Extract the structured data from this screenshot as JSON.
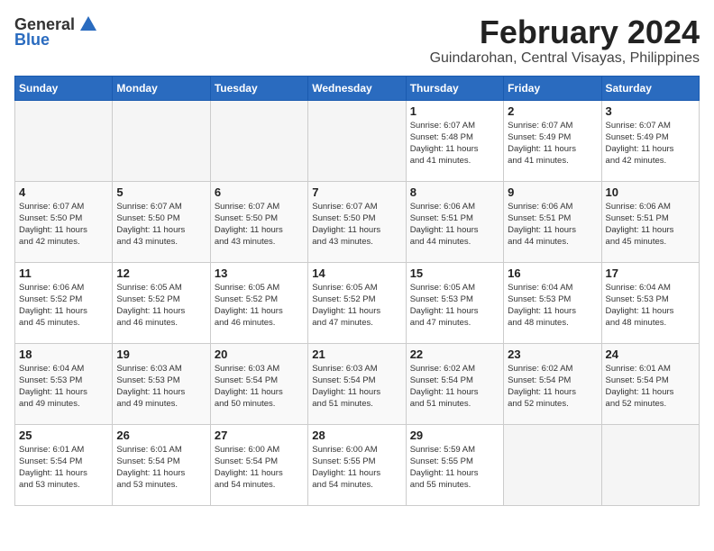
{
  "logo": {
    "general": "General",
    "blue": "Blue"
  },
  "title": {
    "month": "February 2024",
    "location": "Guindarohan, Central Visayas, Philippines"
  },
  "headers": [
    "Sunday",
    "Monday",
    "Tuesday",
    "Wednesday",
    "Thursday",
    "Friday",
    "Saturday"
  ],
  "weeks": [
    [
      {
        "day": "",
        "info": ""
      },
      {
        "day": "",
        "info": ""
      },
      {
        "day": "",
        "info": ""
      },
      {
        "day": "",
        "info": ""
      },
      {
        "day": "1",
        "info": "Sunrise: 6:07 AM\nSunset: 5:48 PM\nDaylight: 11 hours\nand 41 minutes."
      },
      {
        "day": "2",
        "info": "Sunrise: 6:07 AM\nSunset: 5:49 PM\nDaylight: 11 hours\nand 41 minutes."
      },
      {
        "day": "3",
        "info": "Sunrise: 6:07 AM\nSunset: 5:49 PM\nDaylight: 11 hours\nand 42 minutes."
      }
    ],
    [
      {
        "day": "4",
        "info": "Sunrise: 6:07 AM\nSunset: 5:50 PM\nDaylight: 11 hours\nand 42 minutes."
      },
      {
        "day": "5",
        "info": "Sunrise: 6:07 AM\nSunset: 5:50 PM\nDaylight: 11 hours\nand 43 minutes."
      },
      {
        "day": "6",
        "info": "Sunrise: 6:07 AM\nSunset: 5:50 PM\nDaylight: 11 hours\nand 43 minutes."
      },
      {
        "day": "7",
        "info": "Sunrise: 6:07 AM\nSunset: 5:50 PM\nDaylight: 11 hours\nand 43 minutes."
      },
      {
        "day": "8",
        "info": "Sunrise: 6:06 AM\nSunset: 5:51 PM\nDaylight: 11 hours\nand 44 minutes."
      },
      {
        "day": "9",
        "info": "Sunrise: 6:06 AM\nSunset: 5:51 PM\nDaylight: 11 hours\nand 44 minutes."
      },
      {
        "day": "10",
        "info": "Sunrise: 6:06 AM\nSunset: 5:51 PM\nDaylight: 11 hours\nand 45 minutes."
      }
    ],
    [
      {
        "day": "11",
        "info": "Sunrise: 6:06 AM\nSunset: 5:52 PM\nDaylight: 11 hours\nand 45 minutes."
      },
      {
        "day": "12",
        "info": "Sunrise: 6:05 AM\nSunset: 5:52 PM\nDaylight: 11 hours\nand 46 minutes."
      },
      {
        "day": "13",
        "info": "Sunrise: 6:05 AM\nSunset: 5:52 PM\nDaylight: 11 hours\nand 46 minutes."
      },
      {
        "day": "14",
        "info": "Sunrise: 6:05 AM\nSunset: 5:52 PM\nDaylight: 11 hours\nand 47 minutes."
      },
      {
        "day": "15",
        "info": "Sunrise: 6:05 AM\nSunset: 5:53 PM\nDaylight: 11 hours\nand 47 minutes."
      },
      {
        "day": "16",
        "info": "Sunrise: 6:04 AM\nSunset: 5:53 PM\nDaylight: 11 hours\nand 48 minutes."
      },
      {
        "day": "17",
        "info": "Sunrise: 6:04 AM\nSunset: 5:53 PM\nDaylight: 11 hours\nand 48 minutes."
      }
    ],
    [
      {
        "day": "18",
        "info": "Sunrise: 6:04 AM\nSunset: 5:53 PM\nDaylight: 11 hours\nand 49 minutes."
      },
      {
        "day": "19",
        "info": "Sunrise: 6:03 AM\nSunset: 5:53 PM\nDaylight: 11 hours\nand 49 minutes."
      },
      {
        "day": "20",
        "info": "Sunrise: 6:03 AM\nSunset: 5:54 PM\nDaylight: 11 hours\nand 50 minutes."
      },
      {
        "day": "21",
        "info": "Sunrise: 6:03 AM\nSunset: 5:54 PM\nDaylight: 11 hours\nand 51 minutes."
      },
      {
        "day": "22",
        "info": "Sunrise: 6:02 AM\nSunset: 5:54 PM\nDaylight: 11 hours\nand 51 minutes."
      },
      {
        "day": "23",
        "info": "Sunrise: 6:02 AM\nSunset: 5:54 PM\nDaylight: 11 hours\nand 52 minutes."
      },
      {
        "day": "24",
        "info": "Sunrise: 6:01 AM\nSunset: 5:54 PM\nDaylight: 11 hours\nand 52 minutes."
      }
    ],
    [
      {
        "day": "25",
        "info": "Sunrise: 6:01 AM\nSunset: 5:54 PM\nDaylight: 11 hours\nand 53 minutes."
      },
      {
        "day": "26",
        "info": "Sunrise: 6:01 AM\nSunset: 5:54 PM\nDaylight: 11 hours\nand 53 minutes."
      },
      {
        "day": "27",
        "info": "Sunrise: 6:00 AM\nSunset: 5:54 PM\nDaylight: 11 hours\nand 54 minutes."
      },
      {
        "day": "28",
        "info": "Sunrise: 6:00 AM\nSunset: 5:55 PM\nDaylight: 11 hours\nand 54 minutes."
      },
      {
        "day": "29",
        "info": "Sunrise: 5:59 AM\nSunset: 5:55 PM\nDaylight: 11 hours\nand 55 minutes."
      },
      {
        "day": "",
        "info": ""
      },
      {
        "day": "",
        "info": ""
      }
    ]
  ]
}
